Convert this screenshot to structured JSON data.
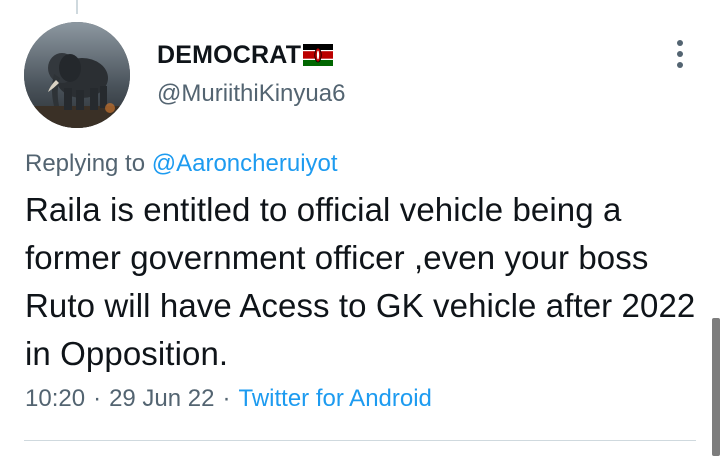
{
  "tweet": {
    "display_name": "DEMOCRAT",
    "flag_icon": "kenya-flag-icon",
    "handle": "@MuriithiKinyua6",
    "reply_prefix": "Replying to",
    "reply_to": "@Aaroncheruiyot",
    "text": "Raila is entitled to official vehicle being a former government officer ,even your boss Ruto will have Acess to GK vehicle after 2022 in Opposition.",
    "time": "10:20",
    "separator": "·",
    "date": "29 Jun 22",
    "source": "Twitter for Android"
  },
  "icons": {
    "more": "more-vertical-icon",
    "avatar": "elephant-avatar"
  },
  "colors": {
    "link": "#1d9bf0",
    "secondary_text": "#536471",
    "primary_text": "#0f1419",
    "divider": "#cfd9de"
  }
}
